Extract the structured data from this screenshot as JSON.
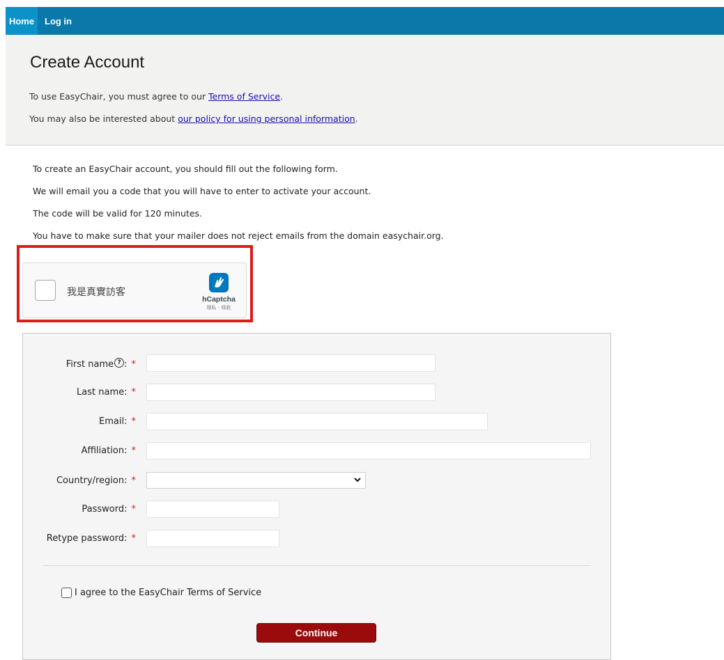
{
  "nav": {
    "home_label": "Home",
    "login_label": "Log in"
  },
  "header": {
    "title": "Create Account",
    "terms_prefix": "To use EasyChair, you must agree to our ",
    "terms_link": "Terms of Service",
    "terms_suffix": ".",
    "policy_prefix": "You may also be interested about ",
    "policy_link": "our policy for using personal information",
    "policy_suffix": "."
  },
  "intro": [
    "To create an EasyChair account, you should fill out the following form.",
    "We will email you a code that you will have to enter to activate your account.",
    "The code will be valid for 120 minutes.",
    "You have to make sure that your mailer does not reject emails from the domain easychair.org."
  ],
  "captcha": {
    "label": "我是真實訪客",
    "brand": "hCaptcha",
    "links": "隱私 - 條款"
  },
  "form": {
    "fields": [
      {
        "label": "First name",
        "value": ""
      },
      {
        "label": "Last name:",
        "value": ""
      },
      {
        "label": "Email:",
        "value": ""
      },
      {
        "label": "Affiliation:",
        "value": ""
      },
      {
        "label": "Country/region:",
        "value": ""
      },
      {
        "label": "Password:",
        "value": ""
      },
      {
        "label": "Retype password:",
        "value": ""
      }
    ],
    "help_icon": "?",
    "first_name_colon": ":",
    "required_mark": "*",
    "agree_label": "I agree to the EasyChair Terms of Service",
    "continue_label": "Continue"
  },
  "colors": {
    "nav_bar": "#0a78a8",
    "nav_home": "#0b92c9",
    "header_band": "#f2f2f0",
    "highlight_frame": "#e01a1a",
    "continue_button": "#9b0b0b",
    "required_mark": "#d21c1c"
  }
}
